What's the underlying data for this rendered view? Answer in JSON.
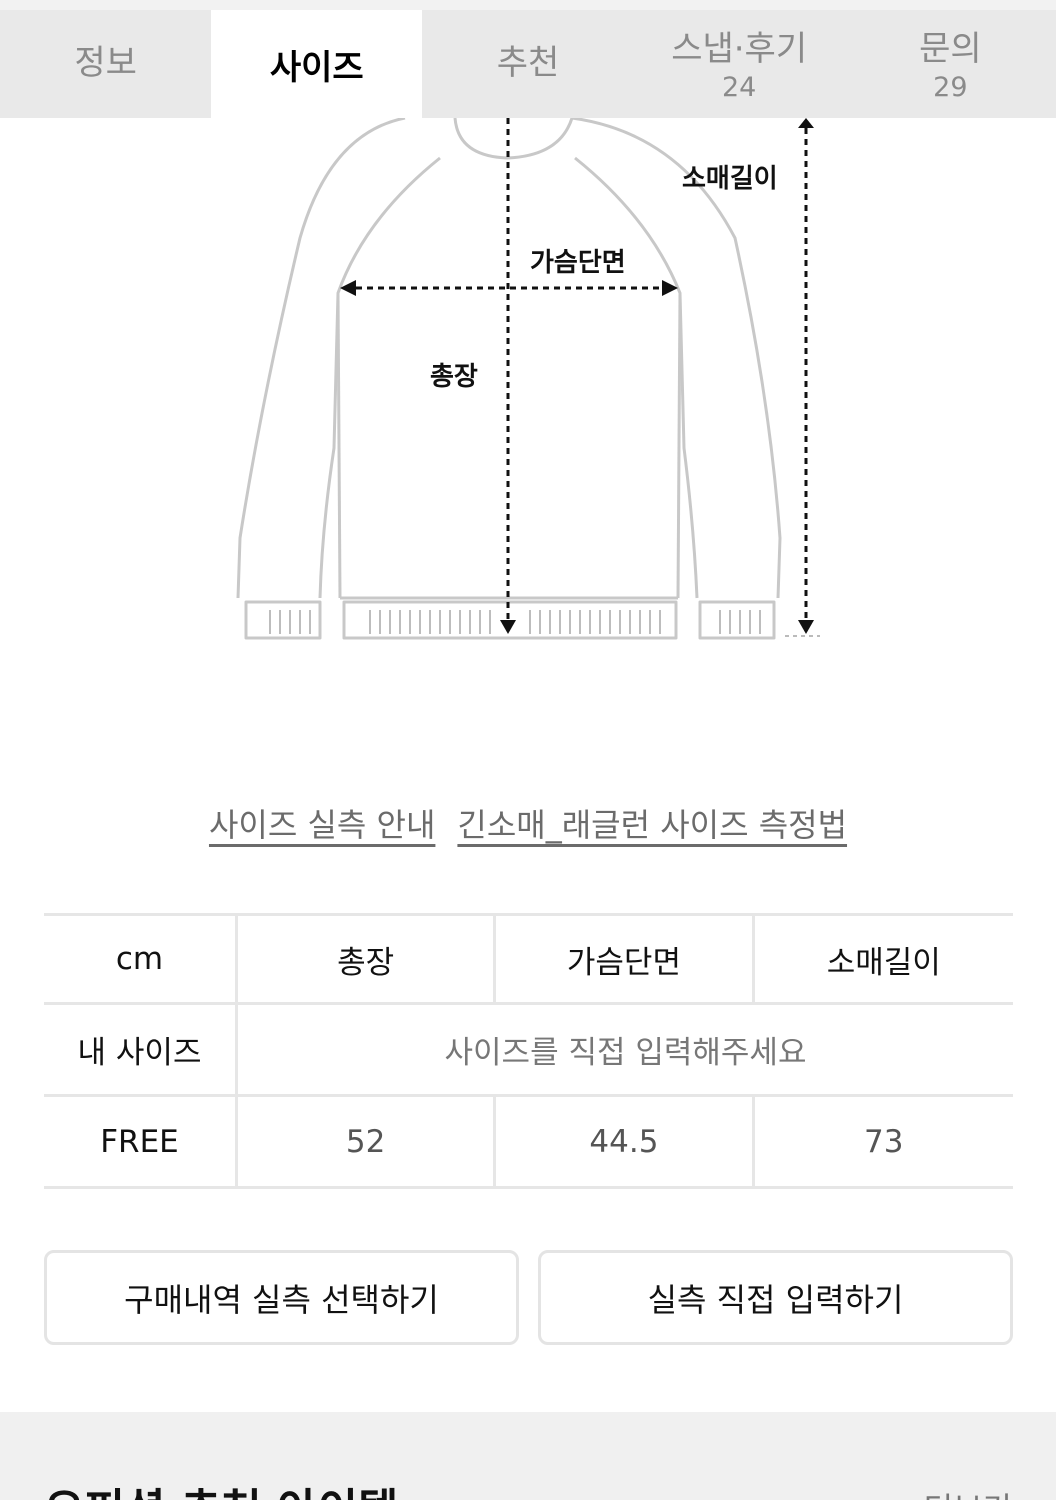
{
  "tabs": [
    {
      "label": "정보",
      "count": ""
    },
    {
      "label": "사이즈",
      "count": ""
    },
    {
      "label": "추천",
      "count": ""
    },
    {
      "label": "스냅·후기",
      "count": "24"
    },
    {
      "label": "문의",
      "count": "29"
    }
  ],
  "active_tab": "사이즈",
  "diagram": {
    "sleeve_label": "소매길이",
    "chest_label": "가슴단면",
    "length_label": "총장"
  },
  "links": {
    "guide": "사이즈 실측 안내",
    "method": "긴소매_래글런 사이즈 측정법"
  },
  "size_table": {
    "unit": "cm",
    "headers": [
      "총장",
      "가슴단면",
      "소매길이"
    ],
    "my_size_label": "내 사이즈",
    "my_size_placeholder": "사이즈를 직접 입력해주세요",
    "rows": [
      {
        "size": "FREE",
        "values": [
          "52",
          "44.5",
          "73"
        ]
      }
    ]
  },
  "buttons": {
    "purchase_history": "구매내역 실측 선택하기",
    "direct_input": "실측 직접 입력하기"
  },
  "recommend": {
    "title": "오피셜 추천 아이템",
    "more": "더보기"
  },
  "colors": {
    "tab_bg": "#e9e9e9",
    "border": "#e6e6e6",
    "section_bg": "#f0f0f0"
  }
}
